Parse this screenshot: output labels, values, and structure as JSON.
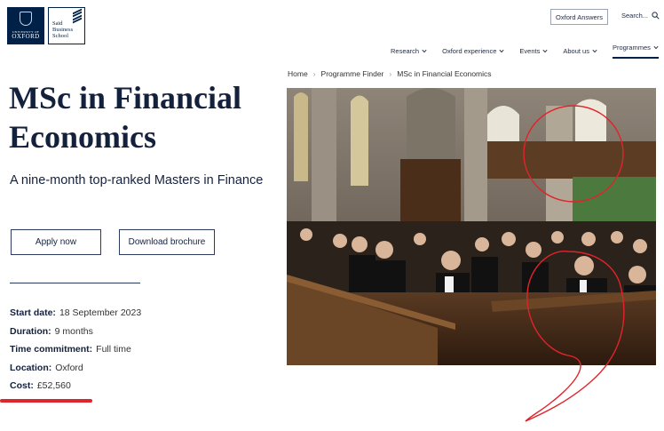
{
  "header": {
    "oxford_logo": {
      "line1": "UNIVERSITY OF",
      "line2": "OXFORD"
    },
    "said_logo": {
      "line1": "Saïd",
      "line2": "Business",
      "line3": "School"
    },
    "answers_label": "Oxford Answers",
    "search_label": "Search..."
  },
  "nav": {
    "items": [
      {
        "label": "Research"
      },
      {
        "label": "Oxford experience"
      },
      {
        "label": "Events"
      },
      {
        "label": "About us"
      },
      {
        "label": "Programmes"
      }
    ]
  },
  "breadcrumb": [
    "Home",
    "Programme Finder",
    "MSc in Financial Economics"
  ],
  "main": {
    "title": "MSc in Financial Economics",
    "subtitle": "A nine-month top-ranked Masters in Finance",
    "apply_label": "Apply now",
    "brochure_label": "Download brochure",
    "facts": [
      {
        "label": "Start date:",
        "value": "18 September 2023"
      },
      {
        "label": "Duration:",
        "value": "9 months"
      },
      {
        "label": "Time commitment:",
        "value": "Full time"
      },
      {
        "label": "Location:",
        "value": "Oxford"
      },
      {
        "label": "Cost:",
        "value": "£52,560"
      }
    ]
  },
  "colors": {
    "brand_navy": "#002147",
    "annotation_red": "#e0242b"
  }
}
